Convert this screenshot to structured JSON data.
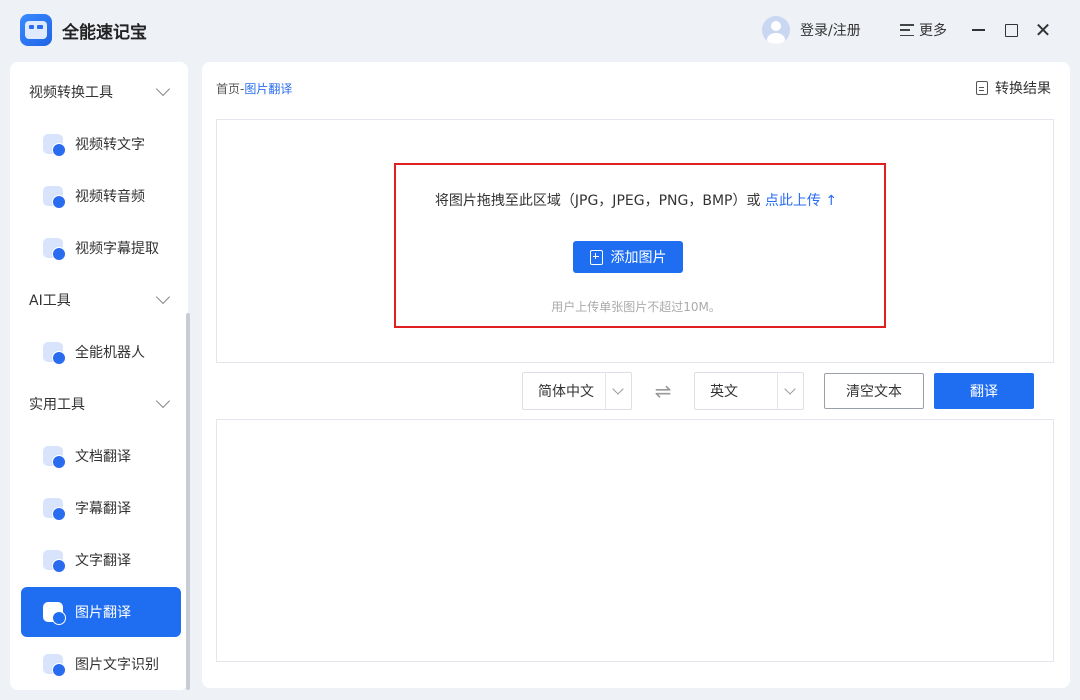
{
  "app": {
    "title": "全能速记宝"
  },
  "header": {
    "login_label": "登录/注册",
    "more_label": "更多"
  },
  "sidebar": {
    "groups": [
      {
        "label": "视频转换工具",
        "items": [
          "视频转文字",
          "视频转音频",
          "视频字幕提取"
        ]
      },
      {
        "label": "AI工具",
        "items": [
          "全能机器人"
        ]
      },
      {
        "label": "实用工具",
        "items": [
          "文档翻译",
          "字幕翻译",
          "文字翻译",
          "图片翻译",
          "图片文字识别"
        ]
      }
    ],
    "active_item": "图片翻译"
  },
  "main": {
    "breadcrumb": {
      "home": "首页",
      "separator": "-",
      "current": "图片翻译"
    },
    "result_link": "转换结果",
    "dropzone": {
      "hint": "将图片拖拽至此区域（JPG，JPEG，PNG，BMP）或",
      "upload_link": "点此上传",
      "add_button": "添加图片",
      "limit_note": "用户上传单张图片不超过10M。"
    },
    "source_language": "简体中文",
    "target_language": "英文",
    "clear_button": "清空文本",
    "translate_button": "翻译"
  },
  "colors": {
    "accent": "#1f6ef2",
    "highlight_border": "#e02020",
    "background": "#eef1f6"
  }
}
